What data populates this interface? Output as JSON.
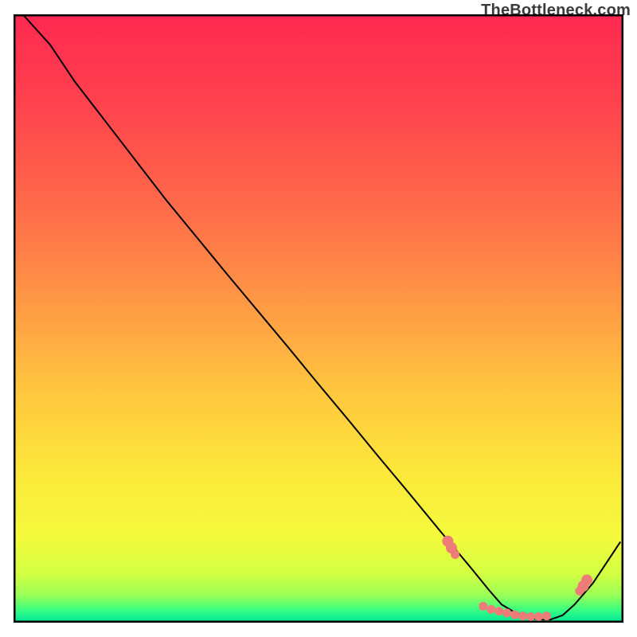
{
  "watermark": "TheBottleneck.com",
  "chart_data": {
    "type": "line",
    "title": "",
    "xlabel": "",
    "ylabel": "",
    "xlim": [
      0,
      100
    ],
    "ylim": [
      0,
      100
    ],
    "grid": false,
    "legend": false,
    "series": [
      {
        "name": "curve",
        "x": [
          1.5,
          6,
          10,
          15,
          20,
          25,
          30,
          35,
          40,
          45,
          50,
          55,
          60,
          65,
          70,
          72,
          75,
          78,
          80,
          82,
          84,
          86,
          88,
          90,
          92,
          95,
          99.5
        ],
        "y": [
          100,
          95,
          89,
          82.5,
          76,
          69.5,
          63.4,
          57.3,
          51.3,
          45.3,
          39.2,
          33.2,
          27.1,
          21.1,
          15.0,
          12.6,
          9.0,
          5.3,
          3.0,
          1.8,
          1.0,
          0.5,
          0.5,
          1.2,
          3.0,
          6.5,
          13.3
        ],
        "color": "#000000",
        "linewidth": 2
      }
    ],
    "markers": {
      "color": "#ed7c78",
      "points": [
        {
          "x": 71.2,
          "y": 13.4,
          "r": 7
        },
        {
          "x": 71.8,
          "y": 12.3,
          "r": 7
        },
        {
          "x": 72.4,
          "y": 11.2,
          "r": 5.5
        },
        {
          "x": 77.0,
          "y": 2.7,
          "r": 5.5
        },
        {
          "x": 78.3,
          "y": 2.2,
          "r": 5.5
        },
        {
          "x": 79.6,
          "y": 1.9,
          "r": 5.5
        },
        {
          "x": 80.9,
          "y": 1.6,
          "r": 5.5
        },
        {
          "x": 82.2,
          "y": 1.3,
          "r": 5.5
        },
        {
          "x": 83.5,
          "y": 1.1,
          "r": 5.5
        },
        {
          "x": 84.8,
          "y": 1.0,
          "r": 5.5
        },
        {
          "x": 86.1,
          "y": 1.0,
          "r": 5.5
        },
        {
          "x": 87.4,
          "y": 1.1,
          "r": 5.5
        },
        {
          "x": 92.8,
          "y": 5.2,
          "r": 5.5
        },
        {
          "x": 93.4,
          "y": 6.0,
          "r": 7
        },
        {
          "x": 94.0,
          "y": 7.0,
          "r": 7
        }
      ]
    },
    "gradient_stops": [
      {
        "offset": 0.0,
        "color": "#ff2951"
      },
      {
        "offset": 0.12,
        "color": "#ff3d4e"
      },
      {
        "offset": 0.25,
        "color": "#ff5a4b"
      },
      {
        "offset": 0.38,
        "color": "#ff7c48"
      },
      {
        "offset": 0.5,
        "color": "#ffa144"
      },
      {
        "offset": 0.62,
        "color": "#ffc63e"
      },
      {
        "offset": 0.75,
        "color": "#fce73a"
      },
      {
        "offset": 0.86,
        "color": "#f4fa3c"
      },
      {
        "offset": 0.92,
        "color": "#d2ff42"
      },
      {
        "offset": 0.955,
        "color": "#99ff57"
      },
      {
        "offset": 0.975,
        "color": "#4aff7a"
      },
      {
        "offset": 0.99,
        "color": "#16f290"
      },
      {
        "offset": 1.0,
        "color": "#0adf92"
      }
    ]
  }
}
